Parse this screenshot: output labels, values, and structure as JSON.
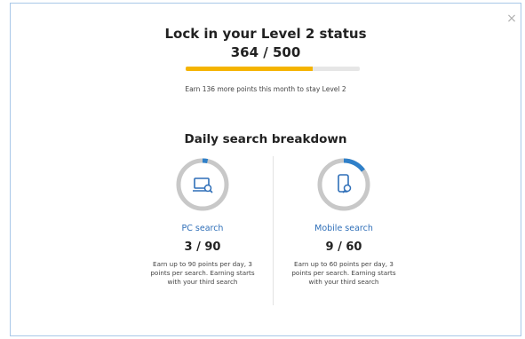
{
  "dialog": {
    "title": "Lock in your Level 2 status",
    "score": "364 / 500",
    "progress": {
      "current": 364,
      "goal": 500,
      "fill_color": "#f5b400",
      "track_color": "#e6e6e6"
    },
    "note": "Earn 136 more points this month to stay Level 2",
    "close_icon": "close-icon",
    "close_glyph": "×"
  },
  "breakdown": {
    "title": "Daily search breakdown",
    "ring_color": "#c8c8c8",
    "ring_progress_color": "#2f80c9",
    "pc": {
      "icon": "pc-search-icon",
      "label": "PC search",
      "count": "3 / 90",
      "earned": 3,
      "max": 90,
      "description": "Earn up to 90 points per day, 3 points per search. Earning starts with your third search"
    },
    "mobile": {
      "icon": "mobile-search-icon",
      "label": "Mobile search",
      "count": "9 / 60",
      "earned": 9,
      "max": 60,
      "description": "Earn up to 60 points per day, 3 points per search. Earning starts with your third search"
    }
  }
}
